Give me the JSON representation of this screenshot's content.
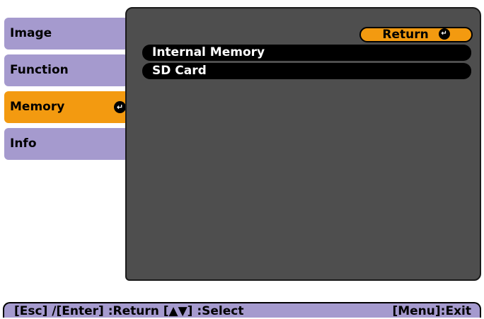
{
  "sidebar": {
    "tabs": [
      {
        "label": "Image"
      },
      {
        "label": "Function"
      },
      {
        "label": "Memory"
      },
      {
        "label": "Info"
      }
    ],
    "active_index": 2,
    "active_icon": "enter-icon"
  },
  "panel": {
    "return_button": {
      "label": "Return",
      "icon": "enter-icon"
    },
    "items": [
      {
        "label": "Internal Memory"
      },
      {
        "label": "SD Card"
      }
    ]
  },
  "help_bar": {
    "left_text": "[Esc] /[Enter] :Return  [▲▼] :Select",
    "right_text": "[Menu]:Exit"
  },
  "colors": {
    "tab_inactive": "#a59ace",
    "tab_active": "#f39a10",
    "panel_background": "#4e4e4e",
    "item_background": "#000000"
  }
}
